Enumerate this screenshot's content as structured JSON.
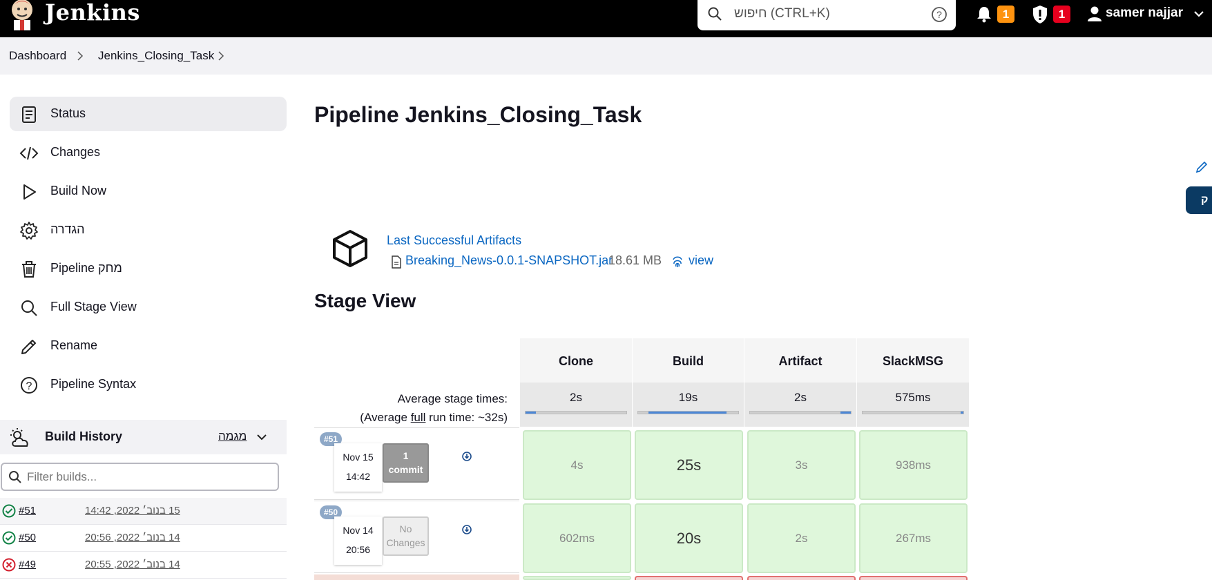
{
  "header": {
    "brand": "Jenkins",
    "search_placeholder": "חיפוש (CTRL+K)",
    "notifications_count": "1",
    "security_count": "1",
    "user_name": "samer najjar"
  },
  "breadcrumb": [
    "Dashboard",
    "Jenkins_Closing_Task"
  ],
  "sidebar": {
    "items": [
      {
        "label": "Status",
        "icon": "status-icon"
      },
      {
        "label": "Changes",
        "icon": "code-icon"
      },
      {
        "label": "Build Now",
        "icon": "play-icon"
      },
      {
        "label": "הגדרה",
        "icon": "gear-icon"
      },
      {
        "label": "Pipeline מחק",
        "icon": "trash-icon"
      },
      {
        "label": "Full Stage View",
        "icon": "search-icon"
      },
      {
        "label": "Rename",
        "icon": "pencil-icon"
      },
      {
        "label": "Pipeline Syntax",
        "icon": "help-icon"
      }
    ]
  },
  "build_history": {
    "title": "Build History",
    "trend": "מגמה",
    "filter_placeholder": "Filter builds...",
    "builds": [
      {
        "number": "#51",
        "date": "15 בנוב׳ 2022, 14:42",
        "status": "success"
      },
      {
        "number": "#50",
        "date": "14 בנוב׳ 2022, 20:56",
        "status": "success"
      },
      {
        "number": "#49",
        "date": "14 בנוב׳ 2022, 20:55",
        "status": "failed"
      }
    ]
  },
  "main": {
    "title": "Pipeline Jenkins_Closing_Task",
    "side_tab": "ק",
    "artifacts": {
      "title": "Last Successful Artifacts",
      "file": "Breaking_News-0.0.1-SNAPSHOT.jar",
      "size": "18.61 MB",
      "view": "view"
    },
    "stage_view": {
      "title": "Stage View",
      "avg_label_1": "Average stage times:",
      "avg_label_2_pre": "(Average ",
      "avg_label_2_link": "full",
      "avg_label_2_post": " run time: ~32s)",
      "stages": [
        {
          "name": "Clone",
          "avg": "2s",
          "bar_fraction": 0.1
        },
        {
          "name": "Build",
          "avg": "19s",
          "bar_fraction": 0.78
        },
        {
          "name": "Artifact",
          "avg": "2s",
          "bar_fraction": 0.1
        },
        {
          "name": "SlackMSG",
          "avg": "575ms",
          "bar_fraction": 0.03
        }
      ],
      "runs": [
        {
          "badge": "#51",
          "date": "Nov 15",
          "time": "14:42",
          "changes_1": "1",
          "changes_2": "commit",
          "cells": [
            "4s",
            "25s",
            "3s",
            "938ms"
          ]
        },
        {
          "badge": "#50",
          "date": "Nov 14",
          "time": "20:56",
          "changes_1": "No",
          "changes_2": "Changes",
          "cells": [
            "602ms",
            "20s",
            "2s",
            "267ms"
          ]
        }
      ]
    }
  },
  "colors": {
    "topbar": "#000000",
    "link": "#0b67c2",
    "success_cell": "#dff7db",
    "badge_orange": "#fe930f",
    "badge_red": "#e6001e"
  }
}
